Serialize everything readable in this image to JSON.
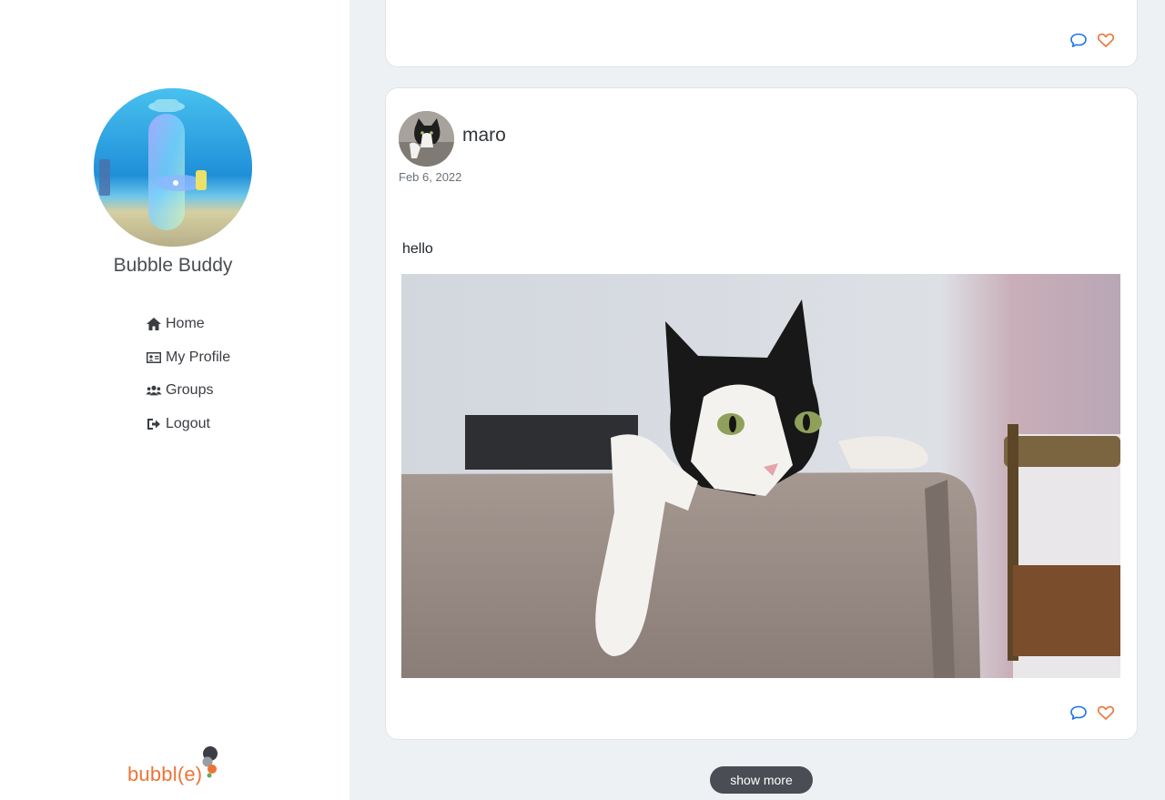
{
  "profile": {
    "name": "Bubble Buddy"
  },
  "nav": {
    "items": [
      {
        "label": "Home",
        "icon": "home-icon"
      },
      {
        "label": "My Profile",
        "icon": "id-card-icon"
      },
      {
        "label": "Groups",
        "icon": "users-icon"
      },
      {
        "label": "Logout",
        "icon": "logout-icon"
      }
    ]
  },
  "logo": {
    "text": "bubbl(e)"
  },
  "posts": [
    {
      "actions": {
        "comment_icon": "comment-icon",
        "like_icon": "heart-icon"
      }
    },
    {
      "author": "maro",
      "date": "Feb 6, 2022",
      "text": "hello",
      "actions": {
        "comment_icon": "comment-icon",
        "like_icon": "heart-icon"
      }
    }
  ],
  "show_more": {
    "label": "show more"
  },
  "colors": {
    "accent": "#ee7436",
    "comment": "#1a73e8",
    "sidebar_bg": "#ffffff",
    "main_bg": "#eef1f4",
    "button_bg": "#4a4d53"
  }
}
